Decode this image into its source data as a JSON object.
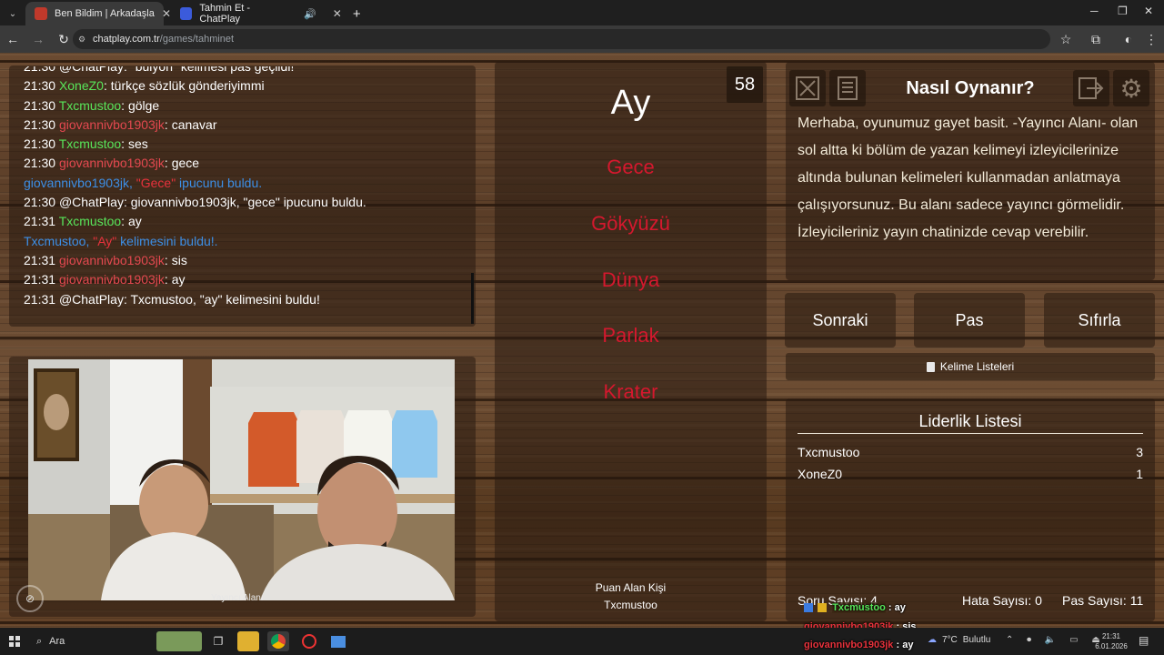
{
  "browser": {
    "tabs": [
      {
        "title": "Ben Bildim | Arkadaşlarınla Onli",
        "active": true,
        "favicon_color": "#c0392b"
      },
      {
        "title": "Tahmin Et - ChatPlay",
        "active": false,
        "favicon_color": "#3b5bdb"
      }
    ],
    "url_host": "chatplay.com.tr",
    "url_path": "/games/tahminet"
  },
  "chat": {
    "messages": [
      {
        "time": "21:30",
        "user": "@ChatPlay",
        "color": "white",
        "text": "\"bulyon\" kelimesi pas geçildi!",
        "first": true
      },
      {
        "time": "21:30",
        "user": "XoneZ0",
        "color": "green",
        "text": "türkçe sözlük gönderiyimmi"
      },
      {
        "time": "21:30",
        "user": "Txcmustoo",
        "color": "green",
        "text": "gölge"
      },
      {
        "time": "21:30",
        "user": "giovannivbo1903jk",
        "color": "red",
        "text": "canavar"
      },
      {
        "time": "21:30",
        "user": "Txcmustoo",
        "color": "green",
        "text": "ses"
      },
      {
        "time": "21:30",
        "user": "giovannivbo1903jk",
        "color": "red",
        "text": "gece"
      },
      {
        "system": true,
        "pre": "giovannivbo1903jk, ",
        "hl": "\"Gece\"",
        "post": " ipucunu buldu."
      },
      {
        "time": "21:30",
        "user": "@ChatPlay",
        "color": "white",
        "text": "giovannivbo1903jk, \"gece\" ipucunu buldu."
      },
      {
        "time": "21:31",
        "user": "Txcmustoo",
        "color": "green",
        "text": "ay"
      },
      {
        "system": true,
        "pre": "Txcmustoo, ",
        "hl": "\"Ay\"",
        "post": " kelimesini buldu!."
      },
      {
        "time": "21:31",
        "user": "giovannivbo1903jk",
        "color": "red",
        "text": "sis"
      },
      {
        "time": "21:31",
        "user": "giovannivbo1903jk",
        "color": "red",
        "text": "ay"
      },
      {
        "time": "21:31",
        "user": "@ChatPlay",
        "color": "white",
        "text": "Txcmustoo, \"ay\" kelimesini buldu!"
      }
    ]
  },
  "cam": {
    "label": "Yayıncı Alanı"
  },
  "game": {
    "timer": "58",
    "word": "Ay",
    "forbidden": [
      "Gece",
      "Gökyüzü",
      "Dünya",
      "Parlak",
      "Krater"
    ],
    "scorer_label": "Puan Alan Kişi",
    "scorer_name": "Txcmustoo"
  },
  "howto": {
    "title": "Nasıl Oynanır?",
    "text": "Merhaba, oyunumuz gayet basit. -Yayıncı Alanı- olan sol altta ki bölüm de yazan kelimeyi izleyicilerinize altında bulunan kelimeleri kullanmadan anlatmaya çalışıyorsunuz. Bu alanı sadece yayıncı görmelidir. İzleyicileriniz yayın chatinizde cevap verebilir."
  },
  "actions": {
    "next": "Sonraki",
    "pass": "Pas",
    "reset": "Sıfırla"
  },
  "lists_button": "Kelime Listeleri",
  "leaderboard": {
    "title": "Liderlik Listesi",
    "rows": [
      {
        "name": "Txcmustoo",
        "score": "3"
      },
      {
        "name": "XoneZ0",
        "score": "1"
      }
    ]
  },
  "stats": {
    "questions": "Soru Sayısı: 4",
    "errors": "Hata Sayısı: 0",
    "passes": "Pas Sayısı: 11"
  },
  "overlay_chat": [
    {
      "user": "Txcmustoo",
      "color": "#58e65a",
      "text": ": ay"
    },
    {
      "user": "giovannivbo1903jk",
      "color": "#e8323c",
      "text": ": sis"
    },
    {
      "user": "giovannivbo1903jk",
      "color": "#e8323c",
      "text": ": ay"
    }
  ],
  "taskbar": {
    "search": "Ara",
    "weather_temp": "7°C",
    "weather_text": "Bulutlu",
    "time": "21:31",
    "date": "6.01.2026"
  }
}
